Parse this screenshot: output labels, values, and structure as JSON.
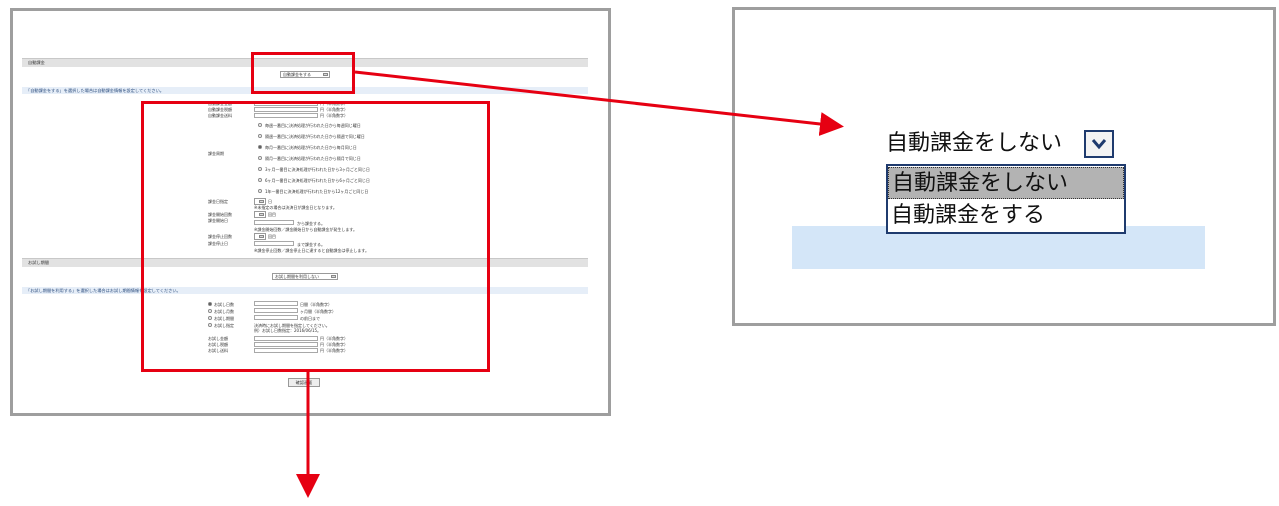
{
  "mini_form": {
    "section1_title": "自動課金",
    "auto_select": "自動課金をする",
    "section1_note": "「自動課金をする」を選択した場合は自動課金情報を設定してください。",
    "fields1": [
      {
        "label": "自動課金金額",
        "suffix": "円（半角数字）"
      },
      {
        "label": "自動課金税額",
        "suffix": "円（半角数字）"
      },
      {
        "label": "自動課金送料",
        "suffix": "円（半角数字）"
      }
    ],
    "cycle_label": "課金周期",
    "cycle_options": [
      "毎週一番目に決済処理が行われた日から毎週同じ曜日",
      "隔週一番目に決済処理が行われた日から隔週で同じ曜日",
      "毎月一番目に決済処理が行われた日から毎月同じ日",
      "隔月一番目に決済処理が行われた日から隔月で同じ日",
      "3ヶ月一番目に決済処理が行われた日から3ヶ月ごと同じ日",
      "6ヶ月一番目に決済処理が行われた日から6ヶ月ごと同じ日",
      "1年一番目に決済処理が行われた日から12ヶ月ごと同じ日"
    ],
    "day_label": "課金日指定",
    "day_unit": "日",
    "day_note": "※未指定の場合は決済日が課金日となります。",
    "start_count_label": "課金開始回数",
    "start_count_unit": "回目",
    "start_date_label": "課金開始日",
    "start_date_suffix": "から課金する。",
    "start_note": "※課金開始回数／課金開始日から自動課金が発生します。",
    "stop_count_label": "課金停止回数",
    "stop_count_unit": "回目",
    "stop_date_label": "課金停止日",
    "stop_date_suffix": "まで課金する。",
    "stop_note": "※課金停止回数／課金停止日に達すると自動課金は停止します。",
    "section2_title": "お試し期間",
    "trial_select": "お試し期間を利用しない",
    "section2_note": "「お試し期間を利用する」を選択した場合はお試し期間情報を設定してください。",
    "trial_options": [
      {
        "label": "お試し日数",
        "suffix": "日間（半角数字）"
      },
      {
        "label": "お試し月数",
        "suffix": "ヶ月間（半角数字）"
      },
      {
        "label": "お試し期間",
        "suffix": "の前日まで"
      },
      {
        "label": "お試し指定",
        "suffix": "決済時にお試し期間を指定してください。"
      }
    ],
    "trial_example": "例）お試し日数指定：2016/06/15。",
    "fields2": [
      {
        "label": "お試し金額",
        "suffix": "円（半角数字）"
      },
      {
        "label": "お試し税額",
        "suffix": "円（半角数字）"
      },
      {
        "label": "お試し送料",
        "suffix": "円（半角数字）"
      }
    ],
    "confirm_button": "確認画面"
  },
  "zoom": {
    "current": "自動課金をしない",
    "options": [
      "自動課金をしない",
      "自動課金をする"
    ],
    "selected_index": 0
  },
  "colors": {
    "highlight": "#e60012",
    "note_bg": "#e6eef8",
    "strip": "#d4e6f8",
    "frame": "#9e9e9e"
  }
}
